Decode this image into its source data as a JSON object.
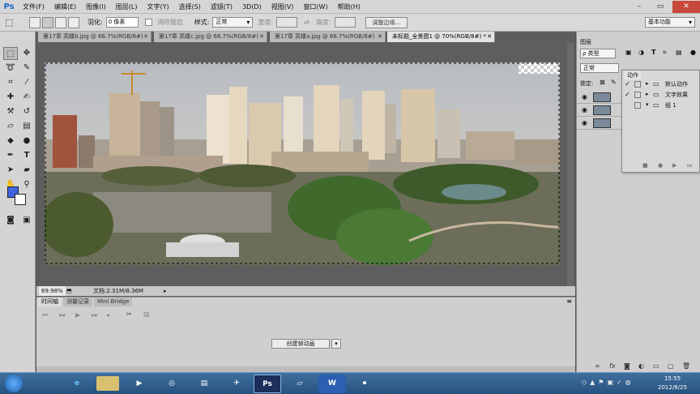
{
  "app": {
    "logo": "Ps"
  },
  "menu": [
    "文件(F)",
    "编辑(E)",
    "图像(I)",
    "图层(L)",
    "文字(Y)",
    "选择(S)",
    "滤镜(T)",
    "3D(D)",
    "视图(V)",
    "窗口(W)",
    "帮助(H)"
  ],
  "window_controls": {
    "minimize": "–",
    "restore": "▭",
    "close": "✕"
  },
  "options": {
    "feather_label": "羽化:",
    "feather_value": "0 像素",
    "antialias_label": "消除锯齿",
    "style_label": "样式:",
    "style_value": "正常",
    "width_label": "宽度:",
    "height_label": "高度:",
    "refine_button": "调整边缘...",
    "workspace": "基本功能"
  },
  "tabs": [
    "第17章 高楼b.jpg @ 66.7%(RGB/8#)",
    "第17章 高楼c.jpg @ 66.7%(RGB/8#)",
    "第17章 高楼a.jpg @ 66.7%(RGB/8#)",
    "未标题_全景图1 @ 70%(RGB/8#) *"
  ],
  "status": {
    "zoom": "69.98%",
    "doc": "文档:2.31M/8.36M"
  },
  "bottom_tabs": [
    "时间轴",
    "测量记录",
    "Mini Bridge"
  ],
  "create_animation_button": "创建帧动画",
  "layers_panel": {
    "title": "图层",
    "filter_label": "ρ 类型",
    "blend_mode": "正常",
    "lock_label": "锁定:"
  },
  "actions_panel": {
    "title": "动作",
    "items": [
      "默认动作",
      "文字效果",
      "组 1"
    ]
  },
  "taskbar": {
    "time": "15:55",
    "date": "2012/8/25",
    "ps_label": "Ps",
    "word_label": "W"
  },
  "colors": {
    "foreground": "#3f66e0",
    "background": "#ffffff",
    "taskbar": "#2f5f8f"
  }
}
